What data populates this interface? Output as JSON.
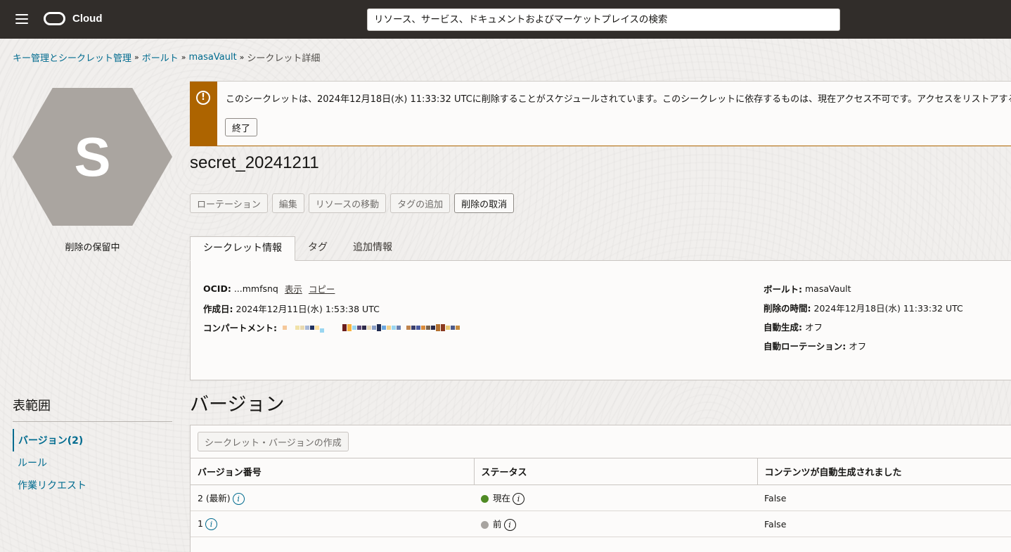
{
  "header": {
    "brand": "Cloud",
    "search_placeholder": "リソース、サービス、ドキュメントおよびマーケットプレイスの検索"
  },
  "breadcrumb": {
    "items": [
      "キー管理とシークレット管理",
      "ボールト",
      "masaVault"
    ],
    "current": "シークレット詳細",
    "separator": "»"
  },
  "resource": {
    "initial": "S",
    "state": "削除の保留中",
    "name": "secret_20241211"
  },
  "alert": {
    "message": "このシークレットは、2024年12月18日(水) 11:33:32 UTCに削除することがスケジュールされています。このシークレットに依存するものは、現在アクセス不可です。アクセスをリストアするには、",
    "dismiss_label": "終了",
    "color": "#ad6400"
  },
  "actions": {
    "rotate": "ローテーション",
    "edit": "編集",
    "move": "リソースの移動",
    "add_tags": "タグの追加",
    "cancel_deletion": "削除の取消"
  },
  "tabs": {
    "secret_info": "シークレット情報",
    "tags": "タグ",
    "additional_info": "追加情報"
  },
  "details": {
    "ocid_label": "OCID:",
    "ocid_value": "...mmfsnq",
    "ocid_show": "表示",
    "ocid_copy": "コピー",
    "created_label": "作成日:",
    "created_value": "2024年12月11日(水) 1:53:38 UTC",
    "compartment_label": "コンパートメント:",
    "vault_label": "ボールト:",
    "vault_value": "masaVault",
    "deletion_time_label": "削除の時間:",
    "deletion_time_value": "2024年12月18日(水) 11:33:32 UTC",
    "auto_generation_label": "自動生成:",
    "auto_generation_value": "オフ",
    "auto_rotation_label": "自動ローテーション:",
    "auto_rotation_value": "オフ"
  },
  "scope": {
    "title": "表範囲",
    "items": [
      "バージョン(2)",
      "ルール",
      "作業リクエスト"
    ]
  },
  "versions": {
    "title": "バージョン",
    "create_label": "シークレット・バージョンの作成",
    "columns": [
      "バージョン番号",
      "ステータス",
      "コンテンツが自動生成されました"
    ],
    "rows": [
      {
        "version": "2 (最新)",
        "status": "現在",
        "status_color": "#4f8a24",
        "auto_generated": "False"
      },
      {
        "version": "1",
        "status": "前",
        "status_color": "#a8a4a0",
        "auto_generated": "False"
      }
    ]
  }
}
